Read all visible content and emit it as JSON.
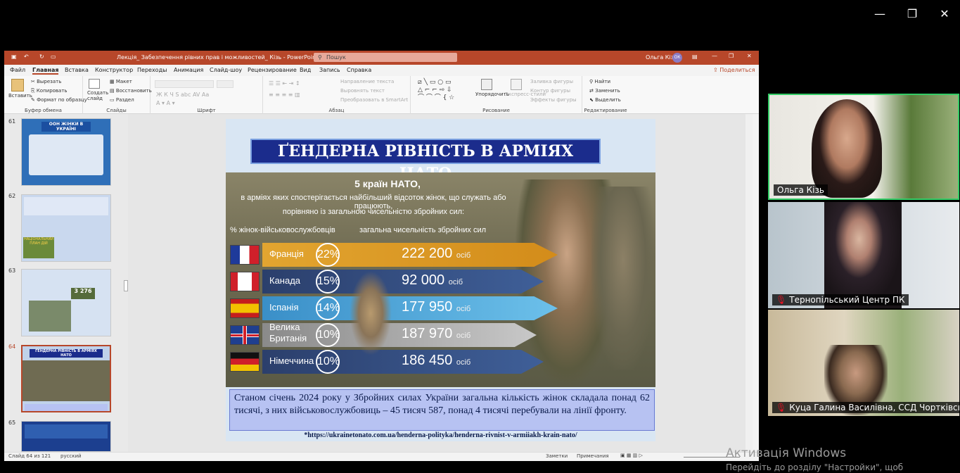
{
  "window_controls": {
    "minimize": "—",
    "restore": "❐",
    "close": "✕"
  },
  "ppt": {
    "title": "Лекція_ Забезпечення рівних прав і можливостей_ Кізь  -  PowerPoint",
    "search_placeholder": "Пошук",
    "user": "Ольга Кізь",
    "user_initials": "ОК",
    "menu": [
      "Файл",
      "Главная",
      "Вставка",
      "Конструктор",
      "Переходы",
      "Анимация",
      "Слайд-шоу",
      "Рецензирование",
      "Вид",
      "Запись",
      "Справка"
    ],
    "share_label": "Поделиться",
    "ribbon": {
      "clipboard": {
        "paste": "Вставить",
        "cut": "Вырезать",
        "copy": "Копировать",
        "format": "Формат по образцу",
        "label": "Буфер обмена"
      },
      "slides": {
        "new": "Создать слайд",
        "layout": "Макет",
        "reset": "Восстановить",
        "section": "Раздел",
        "label": "Слайды"
      },
      "font": {
        "label": "Шрифт"
      },
      "paragraph": {
        "dir": "Направление текста",
        "align": "Выровнять текст",
        "smartart": "Преобразовать в SmartArt",
        "label": "Абзац"
      },
      "drawing": {
        "arrange": "Упорядочить",
        "styles": "Экспресс-стили",
        "fill": "Заливка фигуры",
        "outline": "Контур фигуры",
        "effects": "Эффекты фигуры",
        "label": "Рисование"
      },
      "editing": {
        "find": "Найти",
        "replace": "Заменить",
        "select": "Выделить",
        "label": "Редактирование"
      }
    },
    "thumbs": [
      {
        "num": "61",
        "title": "ООН ЖІНКИ В УКРАЇНІ"
      },
      {
        "num": "62",
        "title": "НАЦІОНАЛЬНИЙ ПЛАН ДІЙ"
      },
      {
        "num": "63",
        "title": "3 276"
      },
      {
        "num": "64",
        "title": "ҐЕНДЕРНА РІВНІСТЬ В АРМІЯХ НАТО"
      },
      {
        "num": "65",
        "title": ""
      }
    ],
    "status": {
      "slide": "Слайд 64 из 121",
      "lang": "русский",
      "notes": "Заметки",
      "comments": "Примечания"
    }
  },
  "slide": {
    "title": "ҐЕНДЕРНА РІВНІСТЬ В АРМІЯХ НАТО",
    "headline": "5 країн НАТО,",
    "subhead1": "в арміях яких спостерігається найбільший відсоток жінок, що служать або працюють,",
    "subhead2": "порівняно із загальною чисельністю збройних сил:",
    "col1": "% жінок-військовослужбовців",
    "col2": "загальна чисельність збройних сил",
    "unit": "осіб",
    "rows": [
      {
        "country": "Франція",
        "pct": "22%",
        "count": "222 200"
      },
      {
        "country": "Канада",
        "pct": "15%",
        "count": "92 000"
      },
      {
        "country": "Іспанія",
        "pct": "14%",
        "count": "177 950"
      },
      {
        "country": "Велика Британія",
        "pct": "10%",
        "count": "187 970"
      },
      {
        "country": "Німеччина",
        "pct": "10%",
        "count": "186 450"
      }
    ],
    "body": "Станом січень 2024 року у Збройних силах України загальна кількість жінок складала понад 62 тисячі, з них військовослужбовиць – 45 тисяч 587, понад 4 тисячі перебували на лінії фронту.",
    "source": "*https://ukrainetonato.com.ua/henderna-polityka/henderna-rivnist-v-armiiakh-krain-nato/"
  },
  "participants": [
    {
      "name": "Ольга Кізь",
      "muted": false
    },
    {
      "name": "Тернопільський Центр ПК",
      "muted": true
    },
    {
      "name": "Куца Галина Василівна, ССД Чортківськ...",
      "muted": true
    }
  ],
  "activation": {
    "line1": "Активація Windows",
    "line2": "Перейдіть до розділу \"Настройки\", щоб"
  }
}
